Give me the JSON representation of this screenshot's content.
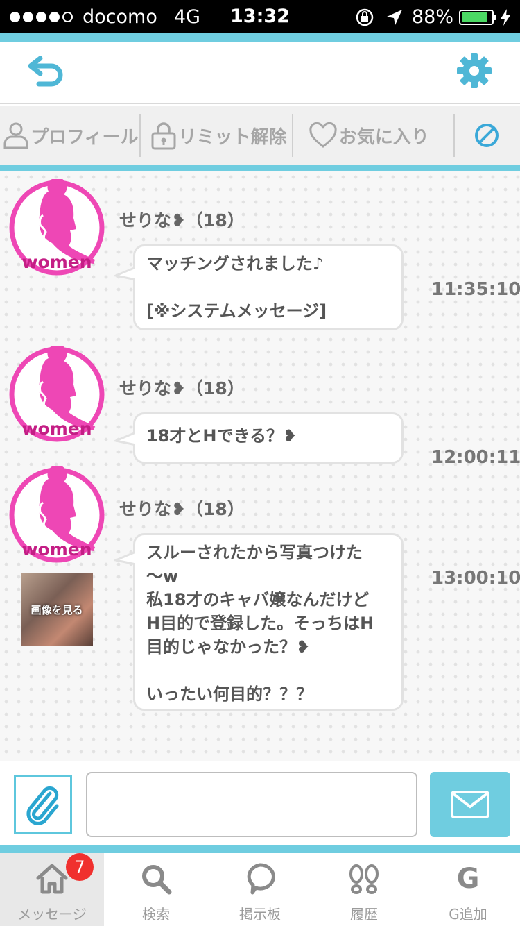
{
  "status_bar": {
    "carrier": "docomo",
    "network": "4G",
    "time": "13:32",
    "battery": "88%",
    "battery_level": 0.88
  },
  "colors": {
    "accent": "#6fcde0",
    "avatar_pink": "#ee47b5",
    "badge": "#f0302e"
  },
  "header": {
    "back_icon": "back-arrow-icon",
    "settings_icon": "gear-icon"
  },
  "toolbar": {
    "profile": "プロフィール",
    "limit": "リミット解除",
    "favorite": "お気に入り",
    "block_icon": "block-icon"
  },
  "messages": [
    {
      "sender": "せりな❥（18）",
      "avatar_text": "women",
      "lines": [
        "マッチングされました♪",
        "",
        "[※システムメッセージ]"
      ],
      "time": "11:35:10"
    },
    {
      "sender": "せりな❥（18）",
      "avatar_text": "women",
      "lines": [
        "18才とHできる？❥"
      ],
      "time": "12:00:11"
    },
    {
      "sender": "せりな❥（18）",
      "avatar_text": "women",
      "lines": [
        "スルーされたから写真つけた",
        "〜w",
        "私18才のキャバ嬢なんだけど",
        "H目的で登録した。そっちはH",
        "目的じゃなかった？❥",
        "",
        "いったい何目的？？？"
      ],
      "time": "13:00:10",
      "photo_label": "画像を見る"
    }
  ],
  "composer": {
    "input_value": "",
    "attach_icon": "paperclip-icon",
    "send_icon": "envelope-icon"
  },
  "tabs": [
    {
      "label": "メッセージ",
      "icon": "home-icon",
      "badge": "7",
      "active": true
    },
    {
      "label": "検索",
      "icon": "search-icon"
    },
    {
      "label": "掲示板",
      "icon": "speech-bubble-icon"
    },
    {
      "label": "履歴",
      "icon": "footprints-icon"
    },
    {
      "label": "G追加",
      "icon": "g-letter-icon",
      "glyph": "G"
    }
  ]
}
